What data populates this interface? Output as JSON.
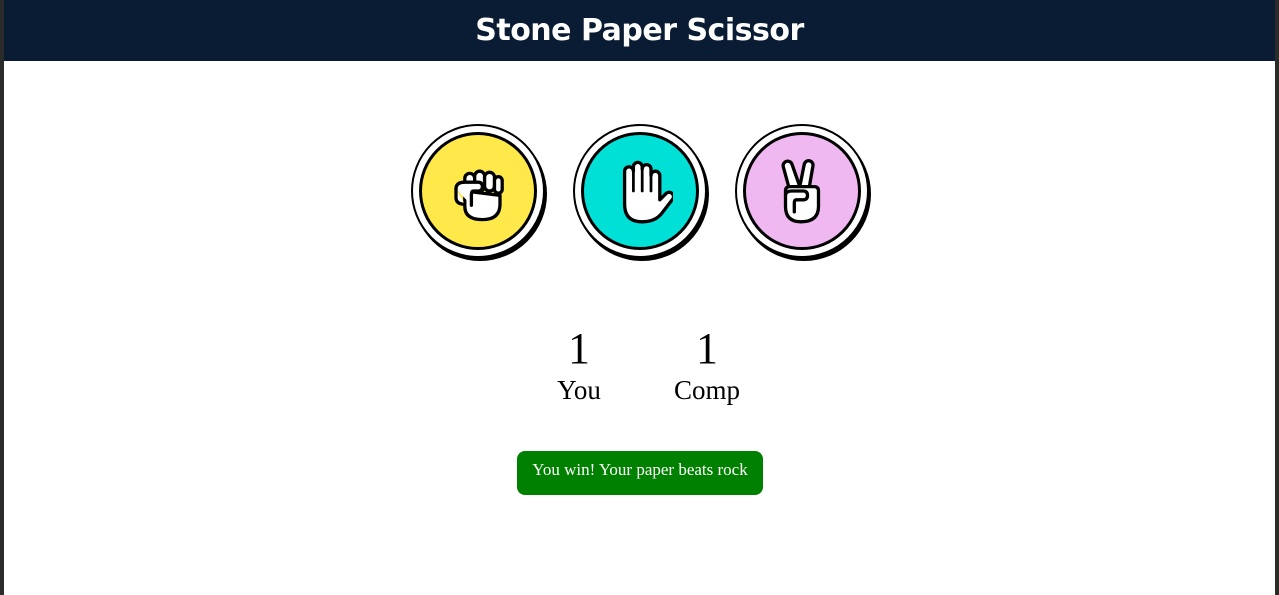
{
  "header": {
    "title": "Stone Paper Scissor"
  },
  "choices": [
    {
      "id": "rock",
      "icon": "fist-icon",
      "color": "#ffe84a"
    },
    {
      "id": "paper",
      "icon": "open-hand-icon",
      "color": "#00e0d6"
    },
    {
      "id": "scissors",
      "icon": "peace-hand-icon",
      "color": "#f0b8f0"
    }
  ],
  "scoreboard": {
    "user": {
      "score": "1",
      "label": "You"
    },
    "comp": {
      "score": "1",
      "label": "Comp"
    }
  },
  "message": {
    "text": "You win! Your paper beats rock",
    "color": "#008000"
  },
  "colors": {
    "header_bg": "#0a1c33",
    "page_bg": "#ffffff"
  }
}
